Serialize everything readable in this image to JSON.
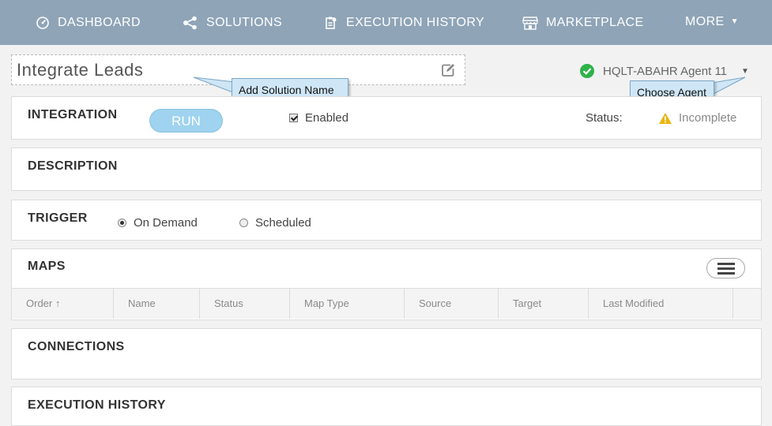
{
  "nav": {
    "items": [
      {
        "label": "DASHBOARD",
        "icon": "gauge-icon"
      },
      {
        "label": "SOLUTIONS",
        "icon": "share-icon"
      },
      {
        "label": "EXECUTION HISTORY",
        "icon": "clipboard-icon"
      },
      {
        "label": "MARKETPLACE",
        "icon": "store-icon"
      },
      {
        "label": "MORE",
        "icon": "caret-down-icon"
      }
    ],
    "background": "#8fa4b7"
  },
  "solution": {
    "name": "Integrate Leads",
    "name_callout": "Add Solution Name"
  },
  "agent": {
    "name": "HQLT-ABAHR Agent 11",
    "callout": "Choose Agent",
    "status_color": "#2fb24a"
  },
  "integration": {
    "title": "INTEGRATION",
    "run_label": "RUN",
    "enabled_label": "Enabled",
    "enabled": true,
    "status_label": "Status:",
    "status_value": "Incomplete",
    "status_color": "#e8b50b"
  },
  "description": {
    "title": "DESCRIPTION"
  },
  "trigger": {
    "title": "TRIGGER",
    "options": [
      {
        "label": "On Demand",
        "selected": true
      },
      {
        "label": "Scheduled",
        "selected": false
      }
    ]
  },
  "maps": {
    "title": "MAPS",
    "columns": [
      "Order",
      "Name",
      "Status",
      "Map Type",
      "Source",
      "Target",
      "Last Modified"
    ],
    "sort_indicator": "↑"
  },
  "connections": {
    "title": "CONNECTIONS"
  },
  "execution_history": {
    "title": "EXECUTION HISTORY"
  }
}
